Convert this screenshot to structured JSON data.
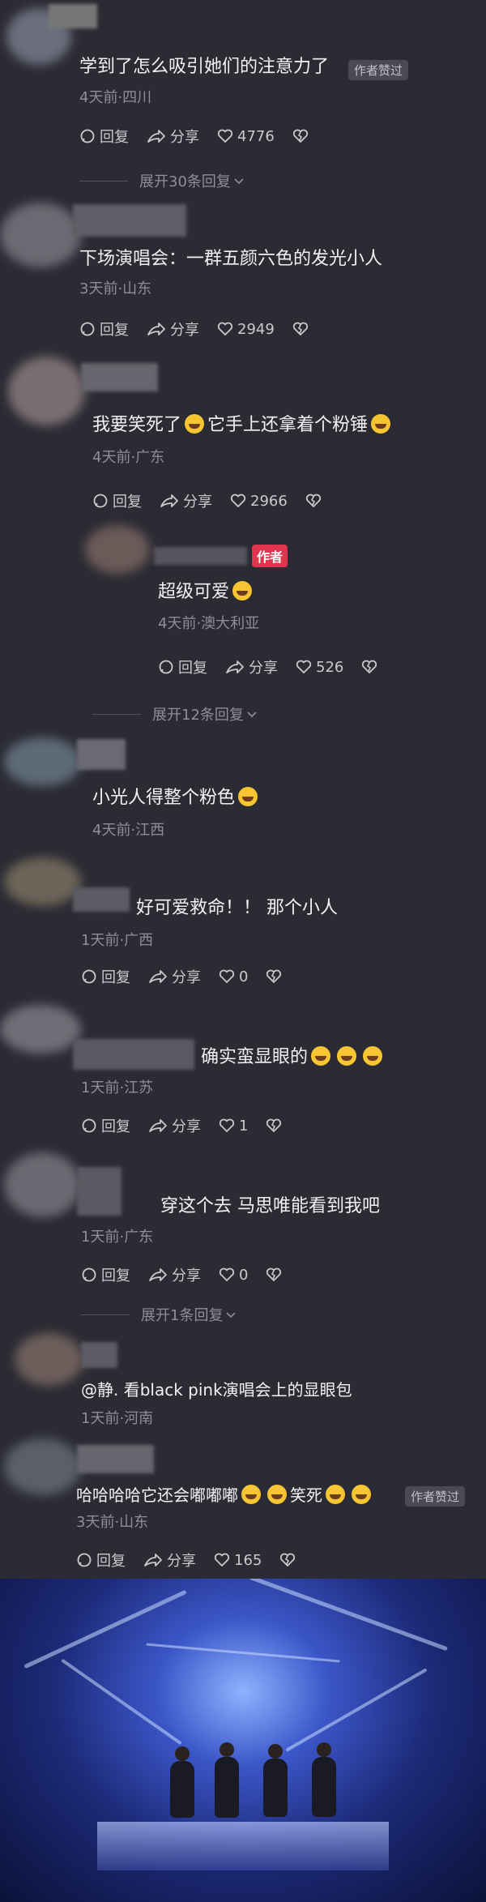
{
  "comments": [
    {
      "text": "学到了怎么吸引她们的注意力了",
      "badge": "作者赞过",
      "meta": "4天前·四川",
      "reply": "回复",
      "share": "分享",
      "likes": "4776",
      "expand": "展开30条回复"
    },
    {
      "text": "下场演唱会：一群五颜六色的发光小人",
      "meta": "3天前·山东",
      "reply": "回复",
      "share": "分享",
      "likes": "2949"
    },
    {
      "text_a": "我要笑死了",
      "text_b": "它手上还拿着个粉锤",
      "meta": "4天前·广东",
      "reply": "回复",
      "share": "分享",
      "likes": "2966"
    },
    {
      "author_badge": "作者",
      "text": "超级可爱",
      "meta": "4天前·澳大利亚",
      "reply": "回复",
      "share": "分享",
      "likes": "526",
      "expand": "展开12条回复"
    },
    {
      "text": "小光人得整个粉色",
      "meta": "4天前·江西"
    },
    {
      "text": "好可爱救命！！ 那个小人",
      "meta": "1天前·广西",
      "reply": "回复",
      "share": "分享",
      "likes": "0"
    },
    {
      "text": "确实蛮显眼的",
      "meta": "1天前·江苏",
      "reply": "回复",
      "share": "分享",
      "likes": "1"
    },
    {
      "text": "穿这个去 马思唯能看到我吧",
      "meta": "1天前·广东",
      "reply": "回复",
      "share": "分享",
      "likes": "0",
      "expand": "展开1条回复"
    },
    {
      "text": "@静. 看black pink演唱会上的显眼包",
      "meta": "1天前·河南"
    },
    {
      "text_a": "哈哈哈哈它还会嘟嘟嘟",
      "text_b": "笑死",
      "badge": "作者赞过",
      "meta": "3天前·山东",
      "reply": "回复",
      "share": "分享",
      "likes": "165"
    }
  ],
  "icons": {
    "reply": "reply-bubble-icon",
    "share": "share-arrow-icon",
    "like": "heart-icon",
    "dislike": "broken-heart-icon",
    "expand": "chevron-down-icon",
    "emoji": "laughing-emoji-icon"
  },
  "colors": {
    "background": "#2b2b34",
    "author_badge": "#e0344f",
    "meta": "#8e8e98"
  }
}
